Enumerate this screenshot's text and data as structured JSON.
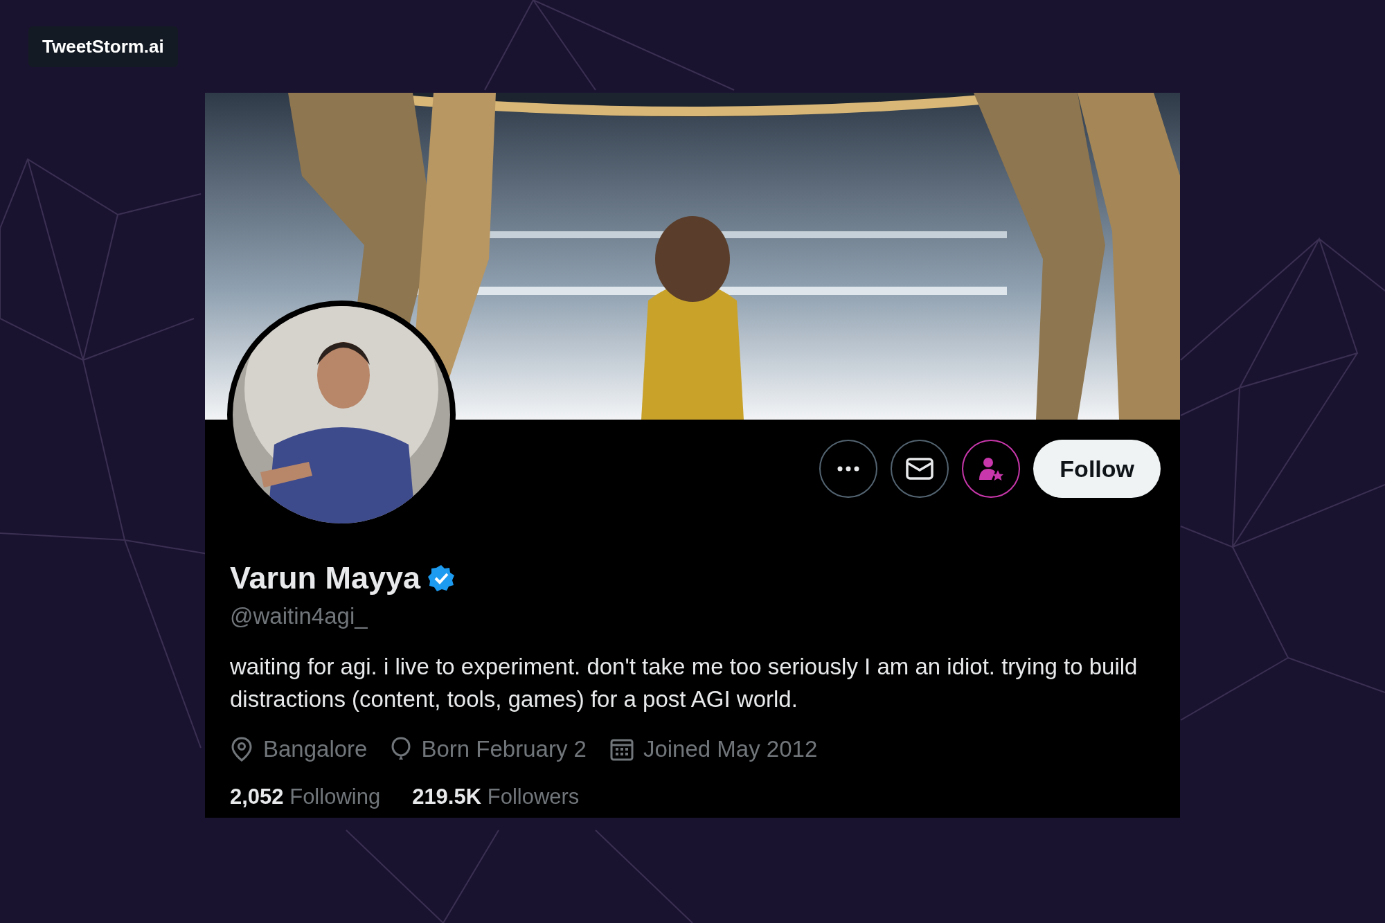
{
  "badge": "TweetStorm.ai",
  "actions": [
    {
      "kind": "more"
    },
    {
      "kind": "message"
    },
    {
      "kind": "subscribe"
    },
    {
      "kind": "follow",
      "label": "Follow"
    }
  ],
  "profile": {
    "name": "Varun Mayya",
    "verified": true,
    "handle": "@waitin4agi_",
    "bio": "waiting for agi. i live to experiment. don't take me too seriously I am an idiot. trying to build distractions (content, tools, games) for a post AGI world.",
    "meta": [
      {
        "kind": "location",
        "text": "Bangalore"
      },
      {
        "kind": "birthday",
        "text": "Born February 2"
      },
      {
        "kind": "joined",
        "text": "Joined May 2012"
      }
    ],
    "stats": [
      "**2,052** Following",
      "**219.5K** Followers"
    ]
  }
}
